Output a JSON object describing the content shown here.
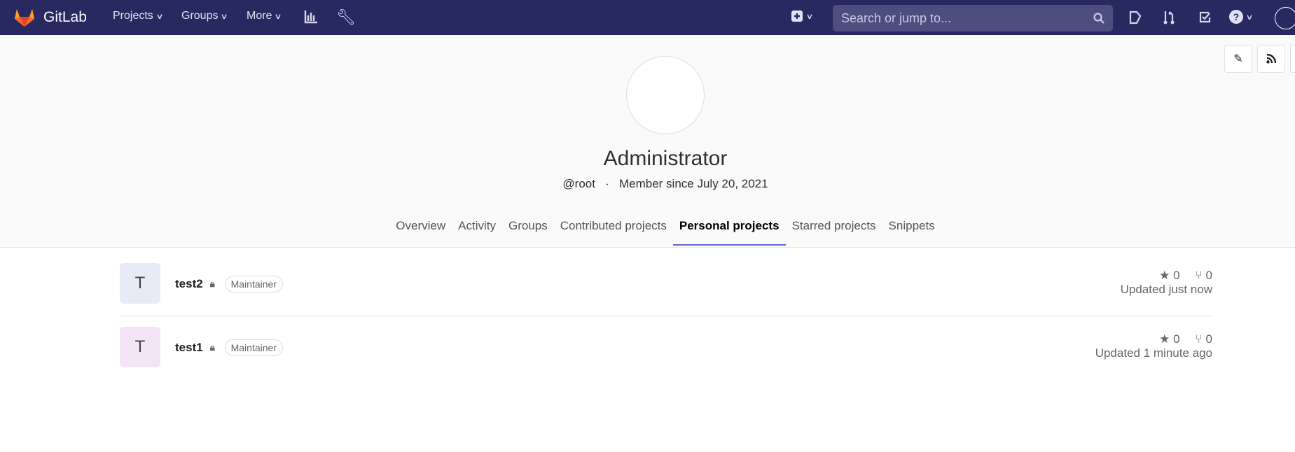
{
  "nav": {
    "brand": "GitLab",
    "menus": [
      "Projects",
      "Groups",
      "More"
    ],
    "search_placeholder": "Search or jump to...",
    "icons": [
      "activity-chart-icon",
      "admin-wrench-icon",
      "new-plus-icon",
      "issues-icon",
      "merge-request-icon",
      "todo-icon",
      "help-icon",
      "user-avatar"
    ]
  },
  "profile": {
    "name": "Administrator",
    "username": "@root",
    "separator": "·",
    "member_since": "Member since July 20, 2021"
  },
  "tabs": [
    {
      "label": "Overview"
    },
    {
      "label": "Activity"
    },
    {
      "label": "Groups"
    },
    {
      "label": "Contributed projects"
    },
    {
      "label": "Personal projects",
      "active": true
    },
    {
      "label": "Starred projects"
    },
    {
      "label": "Snippets"
    }
  ],
  "projects": [
    {
      "initial": "T",
      "name": "test2",
      "role": "Maintainer",
      "stars": "0",
      "forks": "0",
      "updated": "Updated just now",
      "avatar_color": "#e8eaf6"
    },
    {
      "initial": "T",
      "name": "test1",
      "role": "Maintainer",
      "stars": "0",
      "forks": "0",
      "updated": "Updated 1 minute ago",
      "avatar_color": "#f3e5f5"
    }
  ]
}
